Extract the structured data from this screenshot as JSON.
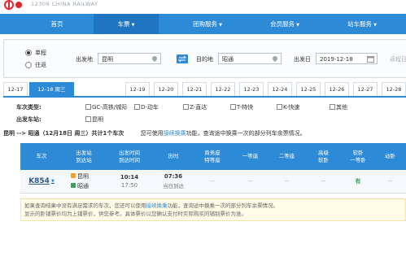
{
  "header": {
    "brand_text": "12306 CHINA RAILWAY",
    "logo_color": "#e4252b"
  },
  "nav": {
    "items": [
      {
        "label": "首页",
        "has_caret": false
      },
      {
        "label": "车票",
        "has_caret": true
      },
      {
        "label": "团购服务",
        "has_caret": true
      },
      {
        "label": "会员服务",
        "has_caret": true
      },
      {
        "label": "站车服务",
        "has_caret": true
      }
    ],
    "active_index": 1,
    "bar_color": "#2d8ad6"
  },
  "search": {
    "trip_one_way": "单程",
    "trip_round": "往返",
    "from_label": "出发地",
    "from_value": "昆明",
    "to_label": "目的地",
    "to_value": "昭通",
    "date_label": "出发日",
    "date_value": "2019-12-18",
    "return_label": "返程日"
  },
  "dates": {
    "tabs": [
      "12-17",
      "12-18 周三",
      "12-19",
      "12-20",
      "12-21",
      "12-22",
      "12-23",
      "12-24",
      "12-25",
      "12-26",
      "12-27",
      "12-28"
    ],
    "active_index": 1
  },
  "filters": {
    "type_label": "车次类型:",
    "types": [
      "GC-高铁/城际",
      "D-动车",
      "Z-直达",
      "T-特快",
      "K-快速",
      "其他"
    ],
    "station_label": "出发车站:",
    "stations": [
      "昆明"
    ]
  },
  "summary": {
    "route": "昆明 --> 昭通（12月18日 周三）共计1个车次",
    "hint_prefix": "您可使用",
    "hint_link": "接续换乘",
    "hint_suffix": "功能，查询途中换乘一次的部分列车余票情况。"
  },
  "table": {
    "headers": [
      "车次",
      "出发站\n到达站",
      "出发时间\n到达时间",
      "历时",
      "商务座\n特等座",
      "一等座",
      "二等座",
      "高级\n软卧",
      "软卧\n一等卧",
      "动卧"
    ],
    "row": {
      "train_no": "K854",
      "from_station": "昆明",
      "to_station": "昭通",
      "depart_time": "10:14",
      "arrive_time": "17:50",
      "duration": "07:36",
      "duration_note": "当日到达",
      "business": "--",
      "first": "--",
      "second": "--",
      "premium_soft": "--",
      "soft_sleeper": "有",
      "moving_sleeper": "--"
    }
  },
  "notice": {
    "line1_prefix": "如果查询结果中没有满足需求的车次，您还可以使用",
    "line1_link": "接续换乘",
    "line1_suffix": "功能，查询途中换乘一次的部分列车余票情况。",
    "line2": "显示的卧铺票价均为上铺票价，供您参考。具体票价以您确认支付时实际购买的铺别票价为准。"
  }
}
